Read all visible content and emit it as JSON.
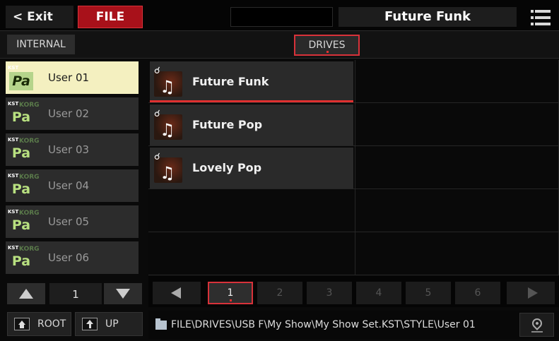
{
  "header": {
    "exit_label": "< Exit",
    "mode_label": "FILE",
    "song_title": "Future Funk"
  },
  "tabs": {
    "internal": "INTERNAL",
    "drives": "DRIVES"
  },
  "folders": [
    {
      "label": "User 01",
      "selected": true
    },
    {
      "label": "User 02",
      "selected": false
    },
    {
      "label": "User 03",
      "selected": false
    },
    {
      "label": "User 04",
      "selected": false
    },
    {
      "label": "User 05",
      "selected": false
    },
    {
      "label": "User 06",
      "selected": false
    }
  ],
  "icon_text": {
    "kst": "KST",
    "korg": "KORG",
    "pa": "Pa"
  },
  "styles": [
    {
      "label": "Future Funk",
      "selected": true
    },
    {
      "label": "Future Pop",
      "selected": false
    },
    {
      "label": "Lovely Pop",
      "selected": false
    }
  ],
  "folder_nav": {
    "page": "1",
    "root_label": "ROOT",
    "up_label": "UP"
  },
  "pagination": {
    "pages": [
      "1",
      "2",
      "3",
      "4",
      "5",
      "6"
    ],
    "active_page": "1"
  },
  "path": "FILE\\DRIVES\\USB F\\My Show\\My Show Set.KST\\STYLE\\User 01",
  "colors": {
    "accent_red": "#d8323a",
    "selected_folder_bg": "#f4f0c0",
    "pa_green": "#b5d48b"
  },
  "icons": {
    "menu": "hamburger-menu-icon",
    "folder": "kst-pa-folder-icon",
    "style": "style-note-icon",
    "root": "home-icon",
    "up": "up-folder-icon",
    "path": "folder-icon",
    "locate": "location-pin-icon"
  }
}
